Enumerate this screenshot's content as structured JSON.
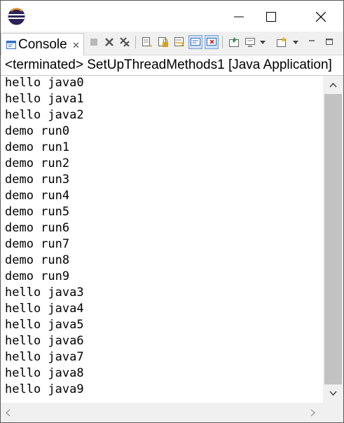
{
  "window": {
    "app_icon": "eclipse-logo-icon",
    "controls": {
      "minimize_icon": "minimize-icon",
      "maximize_icon": "maximize-icon",
      "close_icon": "close-icon"
    }
  },
  "view": {
    "tab_label": "Console",
    "tab_icon": "console-icon",
    "tab_close_glyph": "✕",
    "toolbar_icons": [
      "terminate-icon",
      "remove-launch-icon",
      "remove-all-terminated-icon",
      "clear-console-icon",
      "scroll-lock-icon",
      "word-wrap-icon",
      "show-on-stdout-icon",
      "show-on-stderr-icon",
      "pin-console-icon",
      "display-selected-console-icon",
      "dropdown-icon",
      "open-console-icon",
      "dropdown-icon",
      "view-minimize-icon",
      "view-maximize-icon"
    ]
  },
  "process_line": "<terminated> SetUpThreadMethods1 [Java Application]",
  "console": {
    "lines": [
      "hello java0",
      "hello java1",
      "hello java2",
      "demo run0",
      "demo run1",
      "demo run2",
      "demo run3",
      "demo run4",
      "demo run5",
      "demo run6",
      "demo run7",
      "demo run8",
      "demo run9",
      "hello java3",
      "hello java4",
      "hello java5",
      "hello java6",
      "hello java7",
      "hello java8",
      "hello java9"
    ]
  },
  "colors": {
    "accent_blue": "#2f6ec0",
    "scroll_thumb": "#c2c2c2",
    "toolbar_bg": "#f0f0f0"
  }
}
